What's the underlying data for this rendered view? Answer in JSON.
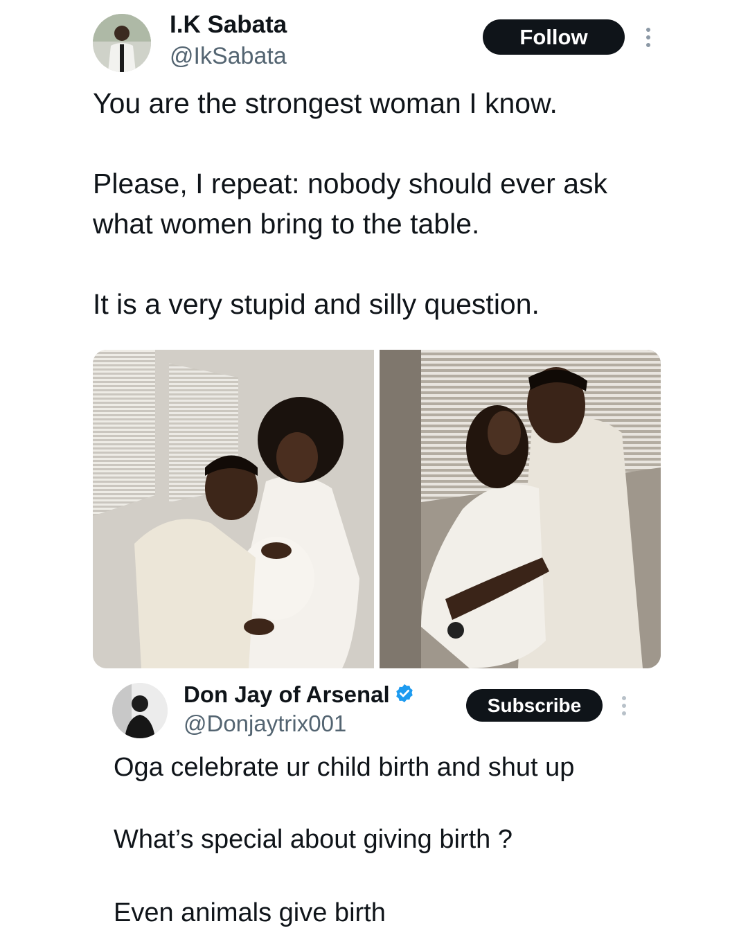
{
  "main_tweet": {
    "author_name": "I.K Sabata",
    "author_handle": "@IkSabata",
    "follow_label": "Follow",
    "avatar_icon": "profile-photo",
    "more_icon": "more-vertical-icon",
    "text_lines": [
      "You are the strongest woman I know.",
      "Please, I repeat: nobody should ever ask",
      "what women bring to the table.",
      "It is a very stupid and silly question."
    ],
    "photos": [
      {
        "description": "couple-pregnancy-photo-1"
      },
      {
        "description": "couple-pregnancy-photo-2"
      }
    ]
  },
  "reply_tweet": {
    "author_name": "Don Jay of Arsenal",
    "verified_badge_icon": "verified-badge-icon",
    "author_handle": "@Donjaytrix001",
    "subscribe_label": "Subscribe",
    "more_icon": "more-vertical-icon",
    "text_lines": [
      "Oga celebrate ur child birth and shut up",
      "What’s special about giving birth ?",
      "Even animals give birth"
    ]
  },
  "colors": {
    "text": "#0f1419",
    "secondary_text": "#536471",
    "button_bg": "#0f1419",
    "verified_blue": "#1d9bf0"
  }
}
